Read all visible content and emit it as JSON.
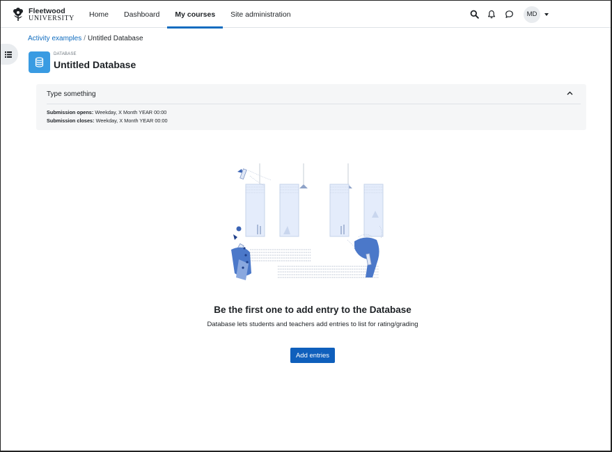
{
  "brand": {
    "line1": "Fleetwood",
    "line2": "UNIVERSITY"
  },
  "nav": {
    "links": [
      {
        "label": "Home"
      },
      {
        "label": "Dashboard"
      },
      {
        "label": "My courses"
      },
      {
        "label": "Site administration"
      }
    ],
    "active_index": 2,
    "icons": [
      "search-icon",
      "bell-icon",
      "chat-icon"
    ],
    "user_initials": "MD"
  },
  "breadcrumb": {
    "parent": "Activity examples",
    "separator": "/",
    "current": "Untitled Database"
  },
  "header": {
    "module_type": "DATABASE",
    "title": "Untitled Database",
    "icon": "database-icon",
    "accent_color": "#399be2"
  },
  "activity_info": {
    "description": "Type something",
    "opens_label": "Submission opens:",
    "opens_value": "Weekday, X Month YEAR 00:00",
    "closes_label": "Submission closes:",
    "closes_value": "Weekday, X Month YEAR 00:00"
  },
  "empty_state": {
    "heading": "Be the first one to add entry to the Database",
    "description": "Database lets students and teachers add entries to list for rating/grading",
    "button_label": "Add entries",
    "button_color": "#0f5fbc"
  }
}
